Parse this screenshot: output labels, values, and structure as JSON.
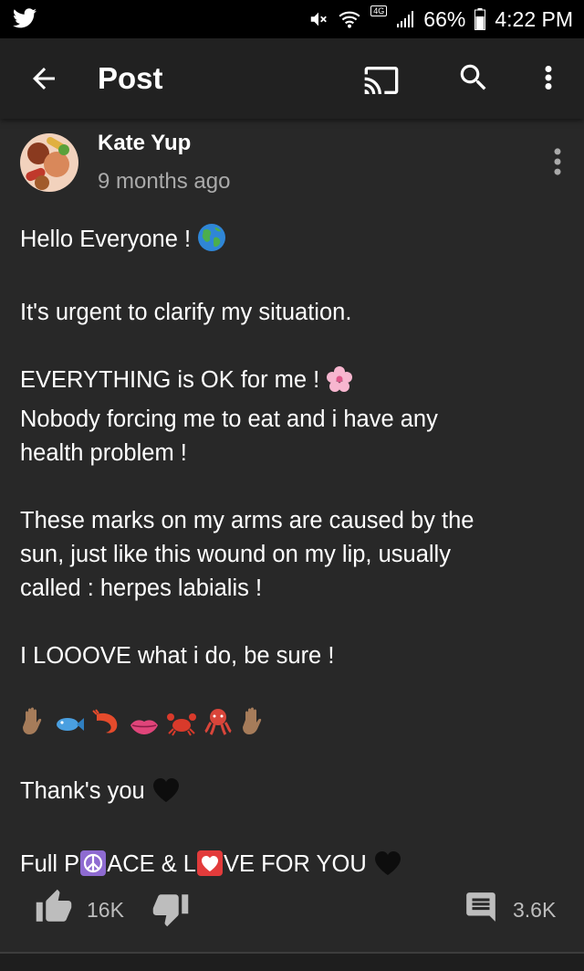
{
  "status_bar": {
    "app_icon": "twitter-bird-icon",
    "icons": [
      "mute-icon",
      "wifi-icon",
      "4g-icon",
      "signal-icon"
    ],
    "network": "4G",
    "battery": "66%",
    "time": "4:22 PM"
  },
  "appbar": {
    "title": "Post",
    "icons": [
      "back-arrow-icon",
      "cast-icon",
      "search-icon",
      "more-vert-icon"
    ]
  },
  "post": {
    "author": "Kate Yup",
    "time_ago": "9 months ago",
    "lines": {
      "l1": "Hello Everyone !",
      "l2": "It's urgent to clarify my situation.",
      "l3": "EVERYTHING is OK for me !",
      "l4a": "Nobody forcing me to eat and i have any",
      "l4b": "health problem !",
      "l5a": "These marks on my arms are caused by the",
      "l5b": "sun, just like this wound on my lip, usually",
      "l5c": "called : herpes labialis !",
      "l6": "I LOOOVE what i do, be sure !",
      "l7": "Thank's you",
      "l8a": "Full P",
      "l8b": "ACE & L",
      "l8c": "VE FOR YOU"
    },
    "emoji_row": [
      "raised-hand-icon",
      "fish-icon",
      "shrimp-icon",
      "lips-icon",
      "crab-icon",
      "octopus-icon",
      "raised-hand-icon"
    ],
    "inline_icons": [
      "globe-icon",
      "cherry-blossom-icon",
      "black-heart-icon",
      "peace-symbol-icon",
      "heart-icon"
    ]
  },
  "actions": {
    "likes": "16K",
    "comments": "3.6K"
  },
  "colors": {
    "background": "#282828",
    "appbar": "#212121",
    "statusbar": "#000000",
    "muted_text": "#aaaaaa",
    "peace_box": "#8e6bd1",
    "heart_box": "#e23b3b"
  }
}
